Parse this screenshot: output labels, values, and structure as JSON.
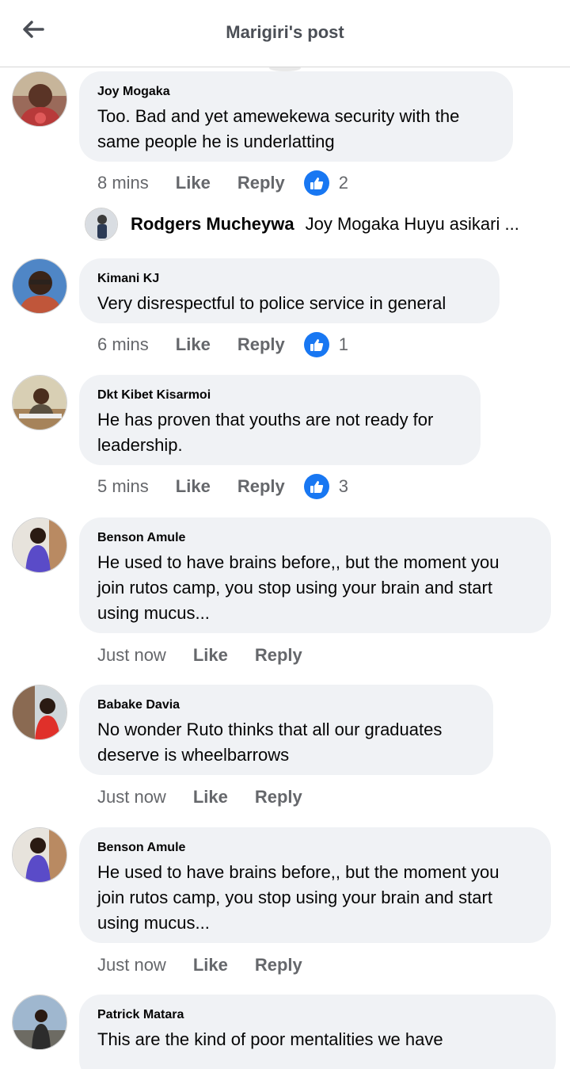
{
  "header": {
    "title": "Marigiri's post",
    "back_icon": "back-arrow-icon"
  },
  "colors": {
    "bubble": "#f0f2f5",
    "like_blue": "#1877f2",
    "meta_gray": "#65676b",
    "title_gray": "#4b4f56"
  },
  "comments": [
    {
      "author": "Joy Mogaka",
      "lines": [
        "Too. Bad and yet amewekewa security with the",
        "same people he is underlatting"
      ],
      "time": "8 mins",
      "like_label": "Like",
      "reply_label": "Reply",
      "reactions": "2"
    },
    {
      "author": "Kimani KJ",
      "lines": [
        "Very disrespectful to police service in general"
      ],
      "time": "6 mins",
      "like_label": "Like",
      "reply_label": "Reply",
      "reactions": "1"
    },
    {
      "author": "Dkt Kibet Kisarmoi",
      "lines": [
        "He has proven that youths are not ready for",
        "leadership."
      ],
      "time": "5 mins",
      "like_label": "Like",
      "reply_label": "Reply",
      "reactions": "3"
    },
    {
      "author": "Benson Amule",
      "lines": [
        "He used to have brains before,, but the moment you",
        "join rutos camp, you stop using your brain and start",
        "using mucus..."
      ],
      "time": "Just now",
      "like_label": "Like",
      "reply_label": "Reply"
    },
    {
      "author": "Babake Davia",
      "lines": [
        "No wonder Ruto thinks that all our graduates",
        "deserve is wheelbarrows"
      ],
      "time": "Just now",
      "like_label": "Like",
      "reply_label": "Reply"
    },
    {
      "author": "Benson Amule",
      "lines": [
        "He used to have brains before,, but the moment you",
        "join rutos camp, you stop using your brain and start",
        "using mucus..."
      ],
      "time": "Just now",
      "like_label": "Like",
      "reply_label": "Reply"
    },
    {
      "author": "Patrick Matara",
      "lines": [
        "This are the kind of poor mentalities we have"
      ]
    }
  ],
  "reply_preview": {
    "author": "Rodgers Mucheywa",
    "text": "Joy Mogaka Huyu asikari ..."
  }
}
